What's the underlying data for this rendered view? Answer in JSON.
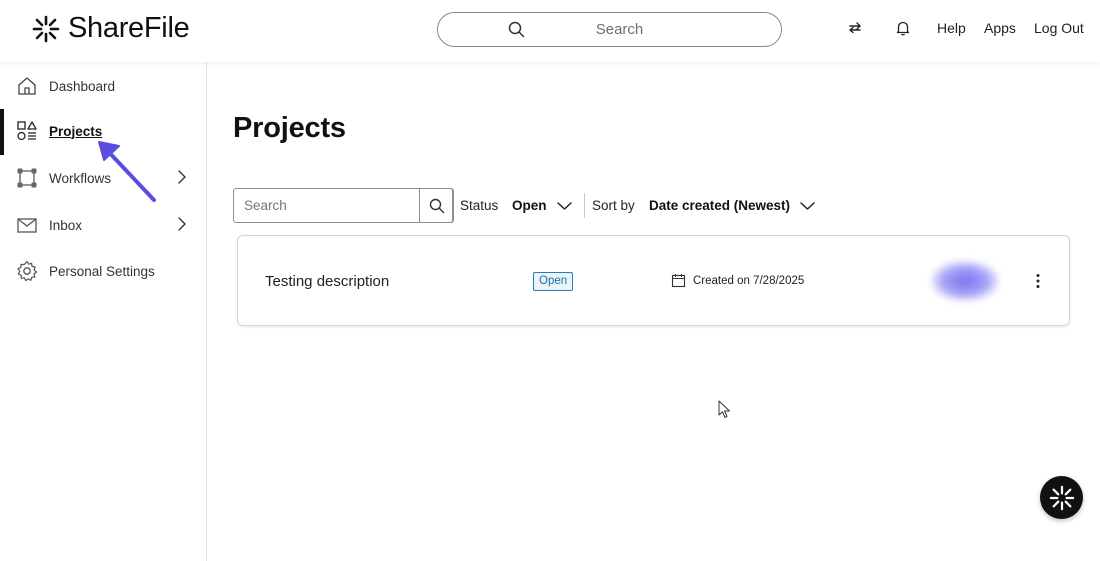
{
  "header": {
    "brand": "ShareFile",
    "search_placeholder": "Search",
    "links": {
      "help": "Help",
      "apps": "Apps",
      "logout": "Log Out"
    },
    "icons": [
      "sharefile-logo-icon",
      "search-icon",
      "swap-arrows-icon",
      "bell-icon"
    ]
  },
  "sidebar": {
    "items": [
      {
        "label": "Dashboard",
        "icon": "home-icon"
      },
      {
        "label": "Projects",
        "icon": "projects-icon",
        "active": true
      },
      {
        "label": "Workflows",
        "icon": "workflows-icon",
        "has_submenu": true
      },
      {
        "label": "Inbox",
        "icon": "mail-icon",
        "has_submenu": true
      },
      {
        "label": "Personal Settings",
        "icon": "gear-icon"
      }
    ]
  },
  "main": {
    "title": "Projects",
    "filter": {
      "search_placeholder": "Search",
      "status_label": "Status",
      "status_value": "Open",
      "sort_label": "Sort by",
      "sort_value": "Date created (Newest)"
    },
    "projects": [
      {
        "name": "Testing description",
        "status": "Open",
        "created": "Created on 7/28/2025"
      }
    ]
  },
  "colors": {
    "accent": "#5b4de0",
    "badge_border": "#2a7db5",
    "text": "#1a1a1a"
  }
}
